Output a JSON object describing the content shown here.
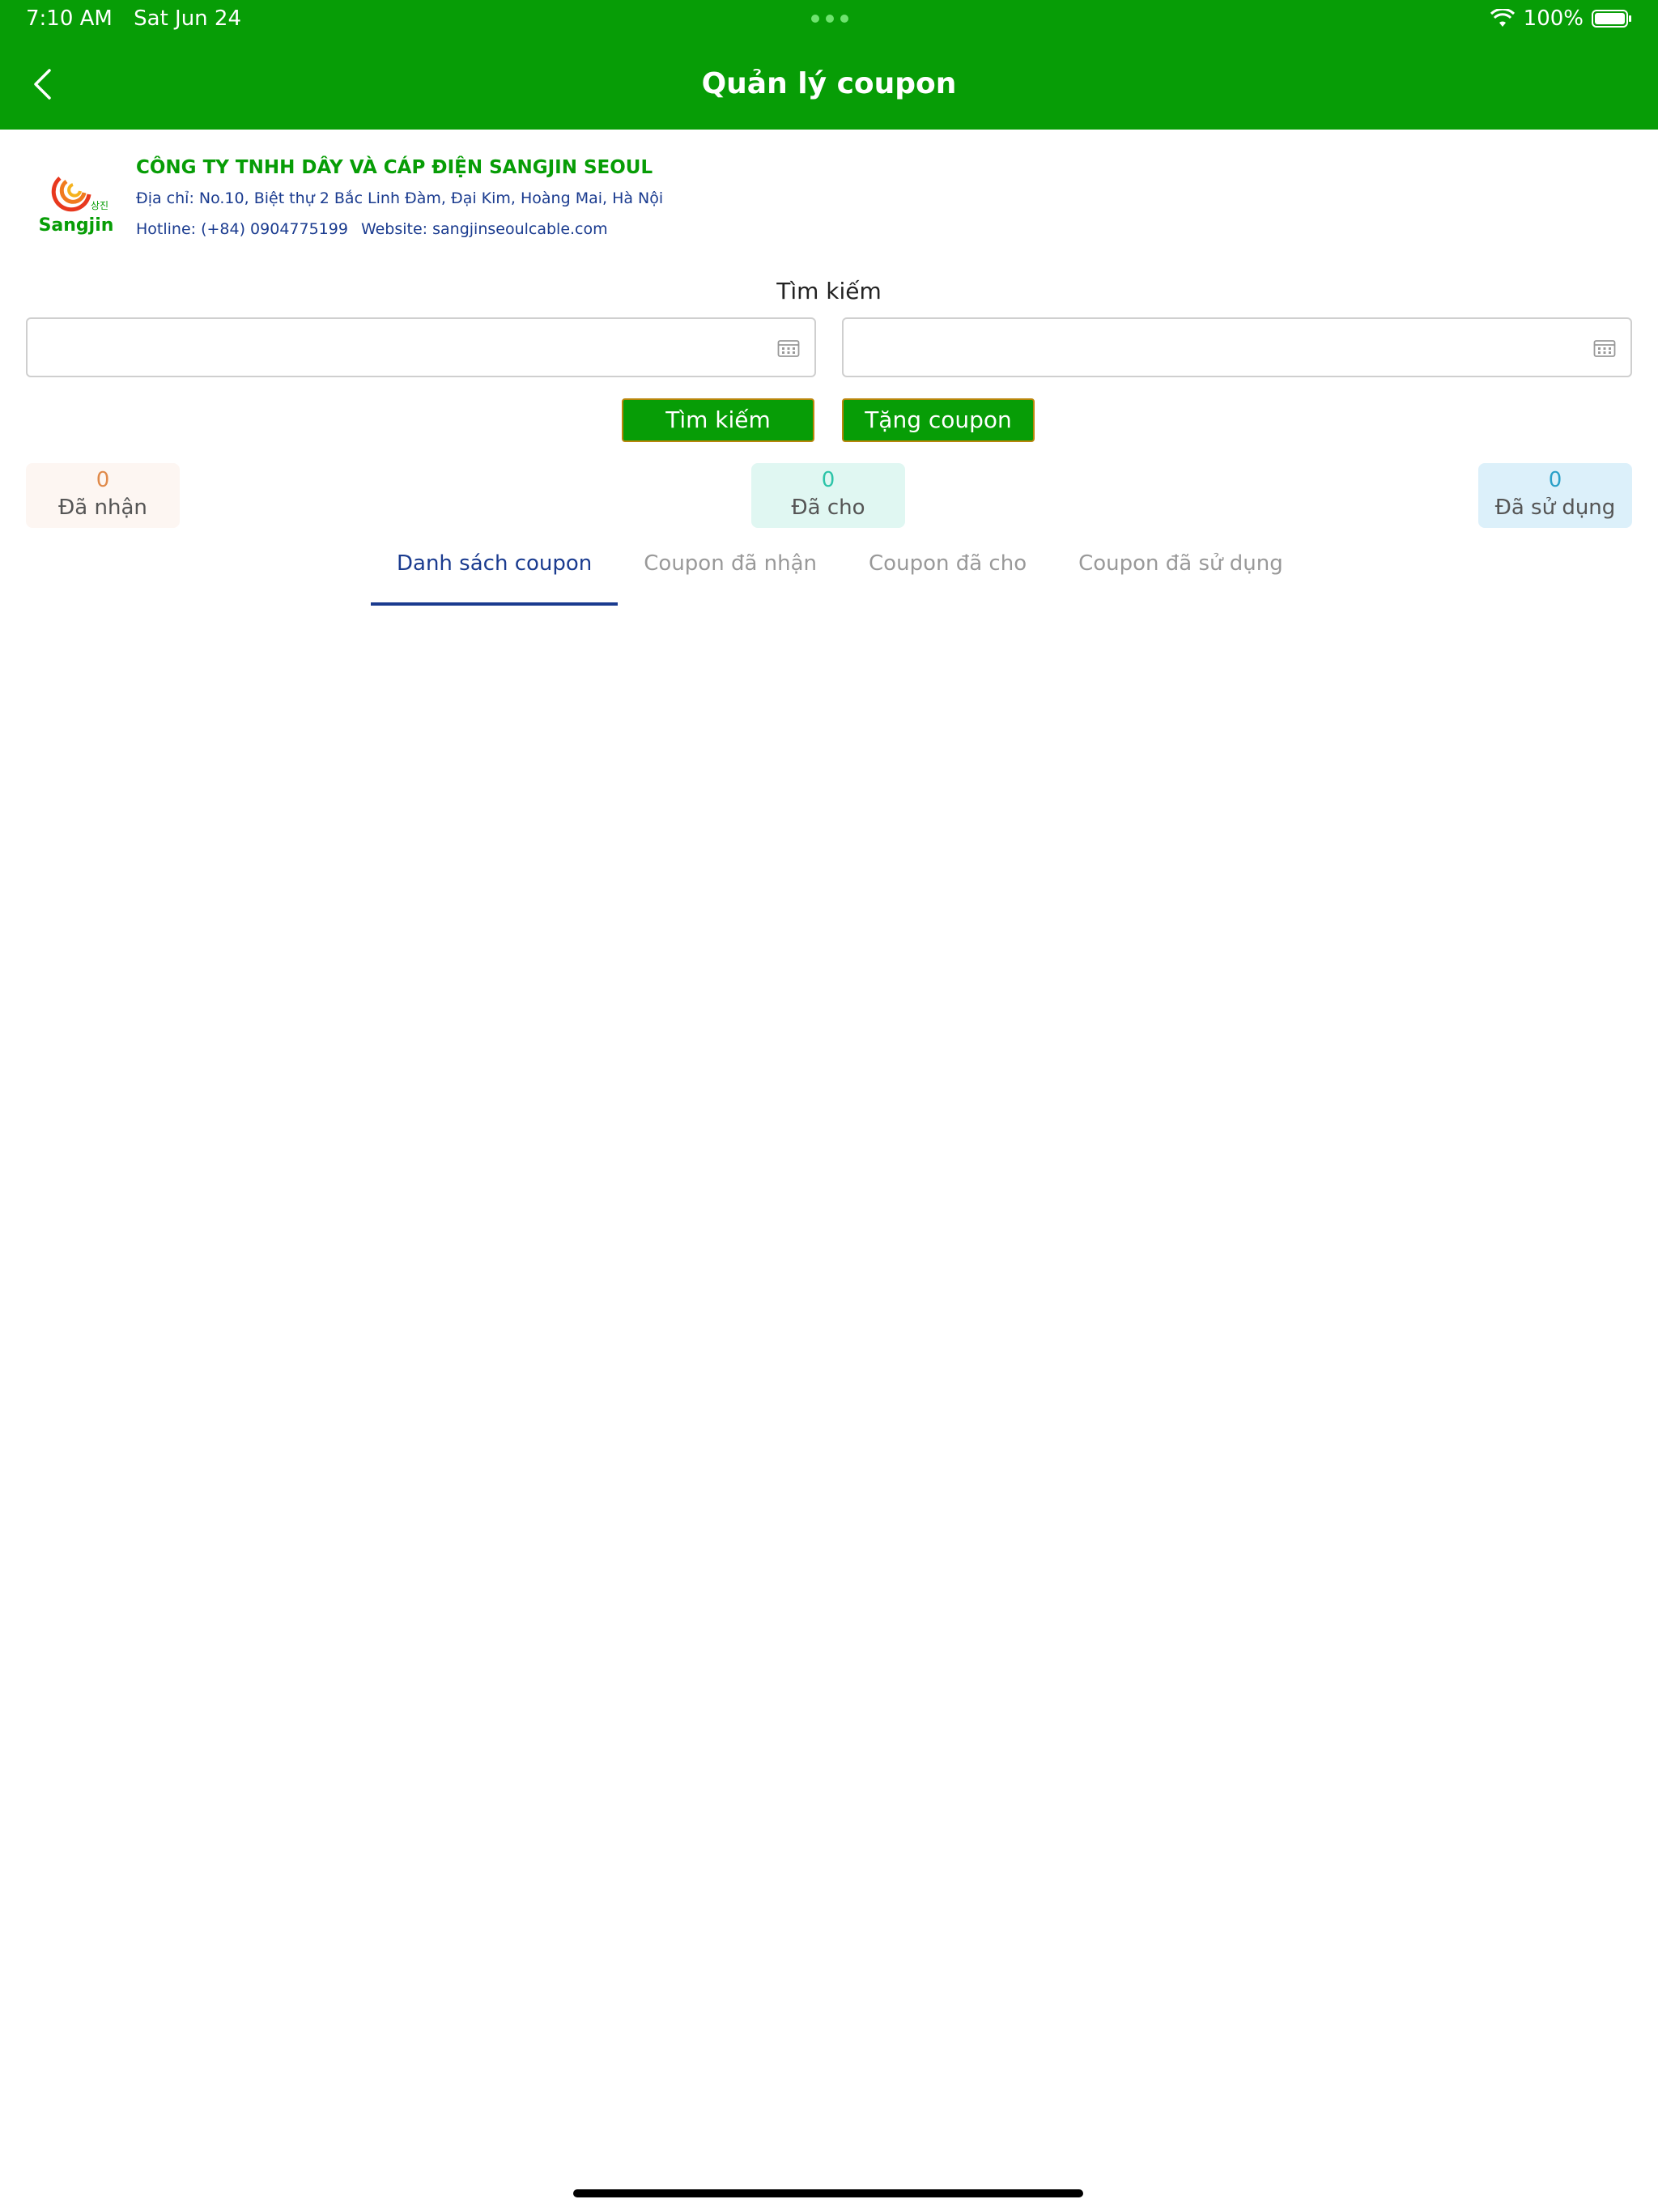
{
  "status_bar": {
    "time": "7:10 AM",
    "date": "Sat Jun 24",
    "battery": "100%"
  },
  "header": {
    "title": "Quản lý coupon"
  },
  "company": {
    "logo_text": "Sangjin",
    "name": "CÔNG TY TNHH DÂY VÀ CÁP ĐIỆN SANGJIN SEOUL",
    "address": "Địa chỉ: No.10, Biệt thự 2 Bắc Linh Đàm, Đại Kim, Hoàng Mai, Hà Nội",
    "hotline": "Hotline: (+84) 0904775199",
    "website": "Website: sangjinseoulcable.com"
  },
  "search": {
    "title": "Tìm kiếm",
    "start_date": "",
    "end_date": "",
    "search_button": "Tìm kiếm",
    "give_button": "Tặng coupon"
  },
  "stats": [
    {
      "value": "0",
      "label": "Đã nhận"
    },
    {
      "value": "0",
      "label": "Đã cho"
    },
    {
      "value": "0",
      "label": "Đã sử dụng"
    }
  ],
  "tabs": [
    {
      "label": "Danh sách coupon",
      "active": true
    },
    {
      "label": "Coupon đã nhận",
      "active": false
    },
    {
      "label": "Coupon đã cho",
      "active": false
    },
    {
      "label": "Coupon đã sử dụng",
      "active": false
    }
  ],
  "colors": {
    "brand_green": "#079D06",
    "tab_active": "#1a3b8f"
  }
}
